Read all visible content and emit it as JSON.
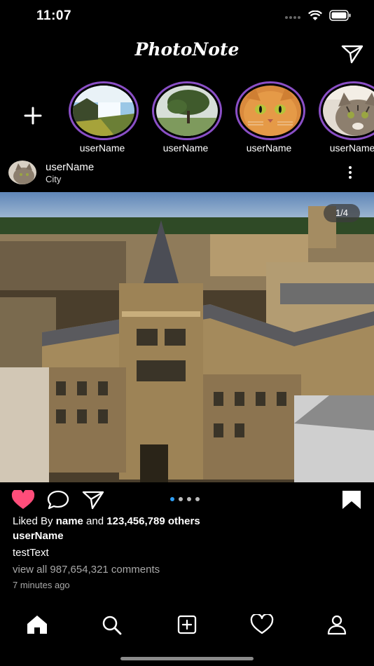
{
  "status_bar": {
    "time": "11:07"
  },
  "header": {
    "title": "PhotoNote"
  },
  "stories": [
    {
      "user": "userName",
      "image": "waterfall-landscape"
    },
    {
      "user": "userName",
      "image": "tree-in-fog"
    },
    {
      "user": "userName",
      "image": "orange-cat"
    },
    {
      "user": "userName",
      "image": "tabby-cat"
    }
  ],
  "post": {
    "user": "userName",
    "location": "City",
    "page_indicator": "1/4",
    "image": "aerial-college-buildings",
    "liked_by_prefix": "Liked By ",
    "liked_by_name": "name",
    "liked_by_and": " and ",
    "liked_by_count": "123,456,789 others",
    "caption_user": "userName",
    "caption_text": "testText",
    "comments_link": "view all 987,654,321 comments",
    "time_ago": "7 minutes ago",
    "carousel": {
      "total": 4,
      "active": 1
    }
  },
  "colors": {
    "like": "#ff4d7a",
    "story_ring": "#8a4fc6",
    "active_dot": "#2e9df3"
  },
  "tab_bar": [
    "home-icon",
    "search-icon",
    "add-post-icon",
    "activity-heart-icon",
    "profile-icon"
  ]
}
